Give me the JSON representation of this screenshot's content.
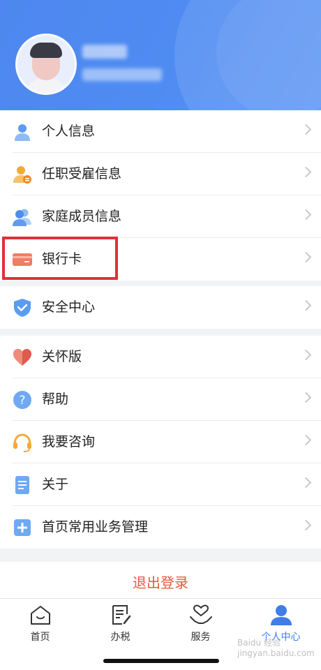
{
  "profile": {
    "name_redacted": true
  },
  "menu_group_1": [
    {
      "label": "个人信息",
      "icon": "person-icon"
    },
    {
      "label": "任职受雇信息",
      "icon": "employment-icon"
    },
    {
      "label": "家庭成员信息",
      "icon": "family-icon"
    },
    {
      "label": "银行卡",
      "icon": "bank-card-icon"
    }
  ],
  "menu_group_2": [
    {
      "label": "安全中心",
      "icon": "shield-icon"
    }
  ],
  "menu_group_3": [
    {
      "label": "关怀版",
      "icon": "heart-icon"
    },
    {
      "label": "帮助",
      "icon": "help-icon"
    },
    {
      "label": "我要咨询",
      "icon": "headset-icon"
    },
    {
      "label": "关于",
      "icon": "document-icon"
    },
    {
      "label": "首页常用业务管理",
      "icon": "plus-square-icon"
    }
  ],
  "logout_label": "退出登录",
  "tabs": [
    {
      "label": "首页",
      "icon": "home-icon"
    },
    {
      "label": "办税",
      "icon": "tax-edit-icon"
    },
    {
      "label": "服务",
      "icon": "service-heart-icon"
    },
    {
      "label": "个人中心",
      "icon": "person-center-icon",
      "active": true
    }
  ],
  "watermark": "Baidu 经验 jingyan.baidu.com",
  "colors": {
    "header_blue": "#4d87ef",
    "highlight_red": "#e0303a",
    "logout_text": "#e35b3c",
    "active_tab": "#3f7de8"
  }
}
